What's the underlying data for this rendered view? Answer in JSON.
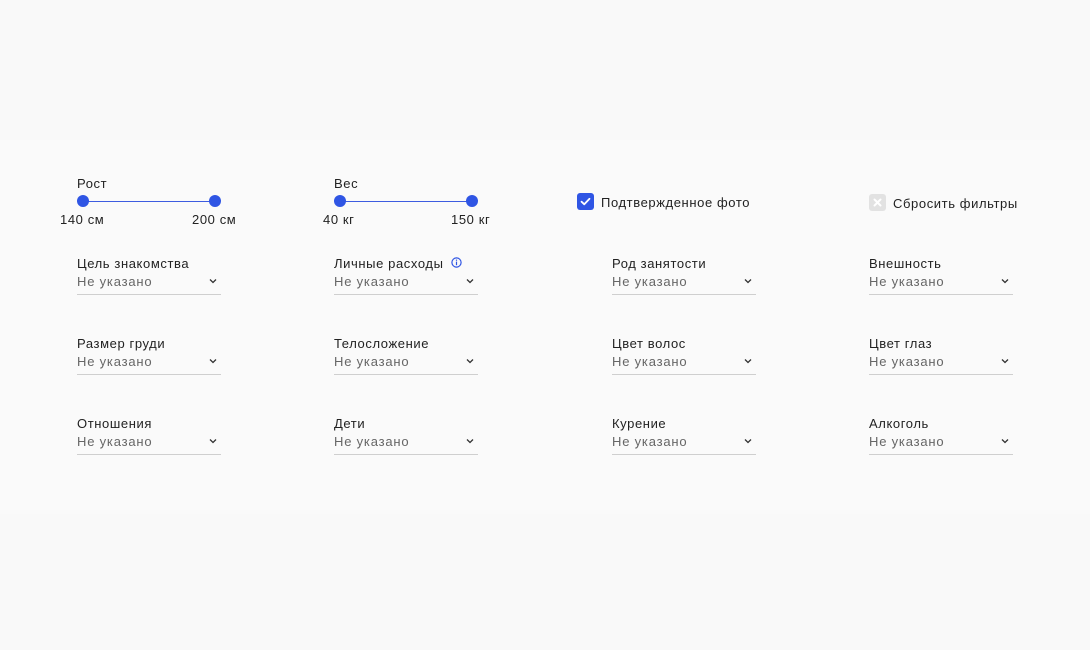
{
  "sliders": {
    "height": {
      "label": "Рост",
      "min_label": "140 см",
      "max_label": "200 см",
      "min": 140,
      "max": 200
    },
    "weight": {
      "label": "Вес",
      "min_label": "40 кг",
      "max_label": "150 кг",
      "min": 40,
      "max": 150
    }
  },
  "verified_photo": {
    "label": "Подтвержденное фото",
    "checked": true
  },
  "reset": {
    "label": "Сбросить фильтры"
  },
  "filters": [
    {
      "label": "Цель знакомства",
      "value": "Не указано"
    },
    {
      "label": "Личные расходы",
      "value": "Не указано",
      "info": true
    },
    {
      "label": "Род занятости",
      "value": "Не указано"
    },
    {
      "label": "Внешность",
      "value": "Не указано"
    },
    {
      "label": "Размер груди",
      "value": "Не указано"
    },
    {
      "label": "Телосложение",
      "value": "Не указано"
    },
    {
      "label": "Цвет волос",
      "value": "Не указано"
    },
    {
      "label": "Цвет глаз",
      "value": "Не указано"
    },
    {
      "label": "Отношения",
      "value": "Не указано"
    },
    {
      "label": "Дети",
      "value": "Не указано"
    },
    {
      "label": "Курение",
      "value": "Не указано"
    },
    {
      "label": "Алкоголь",
      "value": "Не указано"
    }
  ],
  "colors": {
    "accent": "#2f55e4",
    "reset_box": "#e2e2e2",
    "info": "#2f55e4"
  },
  "icons": {
    "checkbox_mark": "check-icon",
    "reset_mark": "close-icon",
    "select_arrow": "chevron-down-icon",
    "info": "info-icon"
  }
}
